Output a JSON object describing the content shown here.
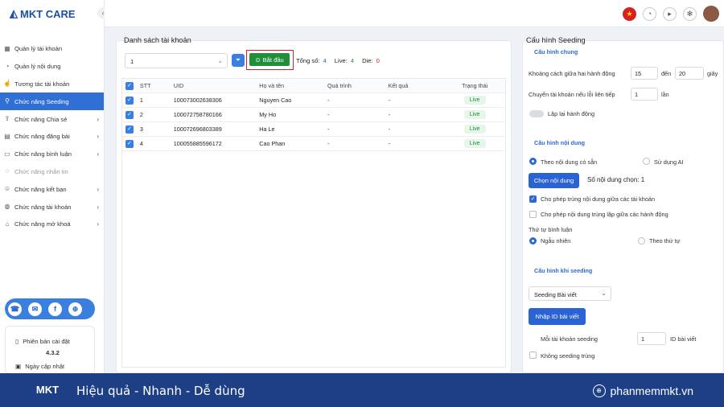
{
  "app": {
    "name": "MKT CARE"
  },
  "sidebar": {
    "items": [
      {
        "label": "Quản lý tài khoản",
        "icon": "grid-icon"
      },
      {
        "label": "Quản lý nội dung",
        "icon": "folder-icon"
      },
      {
        "label": "Tương tác tài khoản",
        "icon": "hand-icon"
      },
      {
        "label": "Chức năng Seeding",
        "icon": "seed-icon"
      },
      {
        "label": "Chức năng Chia sẻ",
        "icon": "share-icon"
      },
      {
        "label": "Chức năng đăng bài",
        "icon": "post-icon"
      },
      {
        "label": "Chức năng bình luận",
        "icon": "comment-icon"
      },
      {
        "label": "Chức năng nhắn tin",
        "icon": "message-icon"
      },
      {
        "label": "Chức năng kết bạn",
        "icon": "add-friend-icon"
      },
      {
        "label": "Chức năng tài khoản",
        "icon": "account-icon"
      },
      {
        "label": "Chức năng mở khoá",
        "icon": "unlock-icon"
      }
    ],
    "version_label": "Phiên bản cài đặt",
    "version": "4.3.2",
    "update_label": "Ngày cập nhật"
  },
  "account_list": {
    "title": "Danh sách tài khoản",
    "select_value": "1",
    "start_label": "Bắt đầu",
    "total_label": "Tổng số:",
    "total": "4",
    "live_label": "Live:",
    "live": "4",
    "die_label": "Die:",
    "die": "0",
    "columns": [
      "STT",
      "UID",
      "Họ và tên",
      "Quá trình",
      "Kết quả",
      "Trạng thái"
    ],
    "rows": [
      {
        "stt": "1",
        "uid": "100073002638306",
        "name": "Nguyen Cao",
        "process": "-",
        "result": "-",
        "status": "Live"
      },
      {
        "stt": "2",
        "uid": "100072758780166",
        "name": "My Ho",
        "process": "-",
        "result": "-",
        "status": "Live"
      },
      {
        "stt": "3",
        "uid": "100072696803389",
        "name": "Ha Le",
        "process": "-",
        "result": "-",
        "status": "Live"
      },
      {
        "stt": "4",
        "uid": "100055885596172",
        "name": "Cao Phan",
        "process": "-",
        "result": "-",
        "status": "Live"
      }
    ]
  },
  "config": {
    "title": "Cấu hình Seeding",
    "general_title": "Cấu hình chung",
    "interval_label": "Khoảng cách giữa hai hành động",
    "interval_from": "15",
    "interval_to_label": "đến",
    "interval_to": "20",
    "interval_unit": "giây",
    "switch_label": "Chuyển tài khoản nếu lỗi liên tiếp",
    "switch_value": "1",
    "switch_unit": "lần",
    "repeat_label": "Lặp lại hành động",
    "content_title": "Cấu hình nội dung",
    "opt_existing": "Theo nội dung có sẵn",
    "opt_ai": "Sử dụng AI",
    "choose_btn": "Chọn nội dung",
    "chosen_label": "Số nội dung chọn: 1",
    "allow_dup_accounts": "Cho phép trùng nội dung giữa các tài khoản",
    "allow_dup_actions": "Cho phép nội dung trùng lặp giữa các hành động",
    "order_label": "Thứ tự bình luận",
    "order_random": "Ngẫu nhiên",
    "order_sequential": "Theo thứ tự",
    "seeding_title": "Cấu hình khi seeding",
    "seeding_type": "Seeding Bài viết",
    "import_btn": "Nhập ID bài viết",
    "per_account_label": "Mỗi tài khoản seeding",
    "per_account_value": "1",
    "per_account_unit": "ID bài viết",
    "no_dup_label": "Không seeding trùng"
  },
  "footer": {
    "logo": "MKT",
    "slogan": "Hiệu quả - Nhanh - Dễ dùng",
    "website": "phanmemmkt.vn"
  },
  "colors": {
    "primary": "#2f6fd6",
    "start": "#1f8f3a",
    "footer": "#1d3f86"
  }
}
